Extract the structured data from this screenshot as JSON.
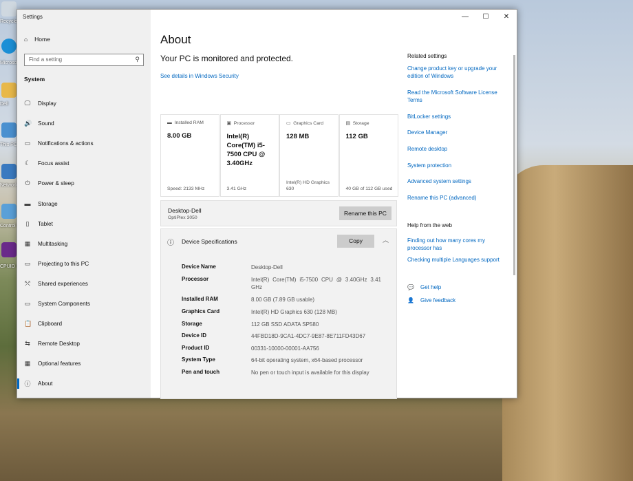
{
  "window": {
    "title": "Settings",
    "minimize": "—",
    "maximize": "☐",
    "close": "✕"
  },
  "sidebar": {
    "home": "Home",
    "search_placeholder": "Find a setting",
    "section": "System",
    "items": [
      {
        "label": "Display",
        "icon": "🖵"
      },
      {
        "label": "Sound",
        "icon": "🔊"
      },
      {
        "label": "Notifications & actions",
        "icon": "▭"
      },
      {
        "label": "Focus assist",
        "icon": "☾"
      },
      {
        "label": "Power & sleep",
        "icon": "⏻"
      },
      {
        "label": "Storage",
        "icon": "▬"
      },
      {
        "label": "Tablet",
        "icon": "▯"
      },
      {
        "label": "Multitasking",
        "icon": "▦"
      },
      {
        "label": "Projecting to this PC",
        "icon": "▭"
      },
      {
        "label": "Shared experiences",
        "icon": "⤲"
      },
      {
        "label": "System Components",
        "icon": "▭"
      },
      {
        "label": "Clipboard",
        "icon": "📋"
      },
      {
        "label": "Remote Desktop",
        "icon": "⇆"
      },
      {
        "label": "Optional features",
        "icon": "▦"
      },
      {
        "label": "About",
        "icon": "ⓘ"
      }
    ]
  },
  "main": {
    "title": "About",
    "protected": "Your PC is monitored and protected.",
    "security_link": "See details in Windows Security",
    "cards": [
      {
        "header": "Installed RAM",
        "value": "8.00 GB",
        "footer": "Speed: 2133 MHz"
      },
      {
        "header": "Processor",
        "value": "Intel(R) Core(TM) i5-7500 CPU @ 3.40GHz",
        "footer": "3.41 GHz"
      },
      {
        "header": "Graphics Card",
        "value": "128 MB",
        "footer": "Intel(R) HD Graphics 630"
      },
      {
        "header": "Storage",
        "value": "112 GB",
        "footer": "40 GB of 112 GB used"
      }
    ],
    "pc_name": "Desktop-Dell",
    "pc_model": "OptiPlex 3050",
    "rename": "Rename this PC",
    "spec_title": "Device Specifications",
    "copy": "Copy",
    "specs": [
      {
        "k": "Device Name",
        "v": "Desktop-Dell"
      },
      {
        "k": "Processor",
        "v": "Intel(R) Core(TM) i5-7500 CPU @ 3.40GHz   3.41 GHz"
      },
      {
        "k": "Installed RAM",
        "v": "8.00 GB (7.89 GB usable)"
      },
      {
        "k": "Graphics Card",
        "v": "Intel(R) HD Graphics 630 (128 MB)"
      },
      {
        "k": "Storage",
        "v": "112 GB SSD ADATA SP580"
      },
      {
        "k": "Device ID",
        "v": "44FBD18D-9CA1-4DC7-9E87-8E711FD43D67"
      },
      {
        "k": "Product ID",
        "v": "00331-10000-00001-AA756"
      },
      {
        "k": "System Type",
        "v": "64-bit operating system, x64-based processor"
      },
      {
        "k": "Pen and touch",
        "v": "No pen or touch input is available for this display"
      }
    ]
  },
  "related": {
    "title": "Related settings",
    "links": [
      "Change product key or upgrade your edition of Windows",
      "Read the Microsoft Software License Terms",
      "BitLocker settings",
      "Device Manager",
      "Remote desktop",
      "System protection",
      "Advanced system settings",
      "Rename this PC (advanced)"
    ],
    "help_title": "Help from the web",
    "help_links": [
      "Finding out how many cores my processor has",
      "Checking multiple Languages support"
    ],
    "get_help": "Get help",
    "feedback": "Give feedback"
  },
  "desktop": {
    "icons": [
      "Recycle",
      "Microsoft Edge",
      "Dell",
      "This PC",
      "Network",
      "Control P",
      "CPUID C"
    ]
  }
}
